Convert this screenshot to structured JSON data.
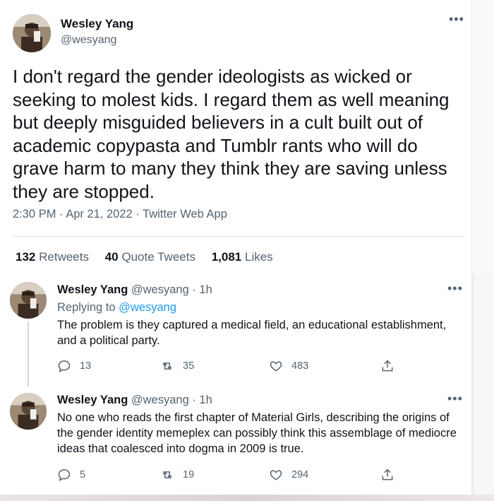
{
  "main_tweet": {
    "name": "Wesley Yang",
    "handle": "@wesyang",
    "more_icon": "more-icon",
    "text": "I don't regard the gender ideologists as wicked or seeking to molest kids. I regard them as well meaning but deeply misguided believers in a cult built out of academic copypasta and Tumblr rants who will do grave harm to many they think they are saving unless they are stopped.",
    "meta": "2:30 PM · Apr 21, 2022 · Twitter Web App",
    "stats": {
      "retweets_count": "132",
      "retweets_label": "Retweets",
      "quotes_count": "40",
      "quotes_label": "Quote Tweets",
      "likes_count": "1,081",
      "likes_label": "Likes"
    }
  },
  "replies": [
    {
      "name": "Wesley Yang",
      "handle_time": "@wesyang · 1h",
      "replying_to_label": "Replying to",
      "replying_to_mention": "@wesyang",
      "text": "The problem is they captured a medical field, an educational establishment, and a political party.",
      "replies": "13",
      "retweets": "35",
      "likes": "483"
    },
    {
      "name": "Wesley Yang",
      "handle_time": "@wesyang · 1h",
      "text": "No one who reads the first chapter of Material Girls, describing the origins of the gender identity memeplex can possibly think this assemblage of mediocre ideas that coalesced into dogma in 2009 is true.",
      "replies": "5",
      "retweets": "19",
      "likes": "294"
    }
  ],
  "colors": {
    "text": "#0f1419",
    "secondary": "#536471",
    "link": "#1d9bf0",
    "divider": "#e1e6ea"
  }
}
